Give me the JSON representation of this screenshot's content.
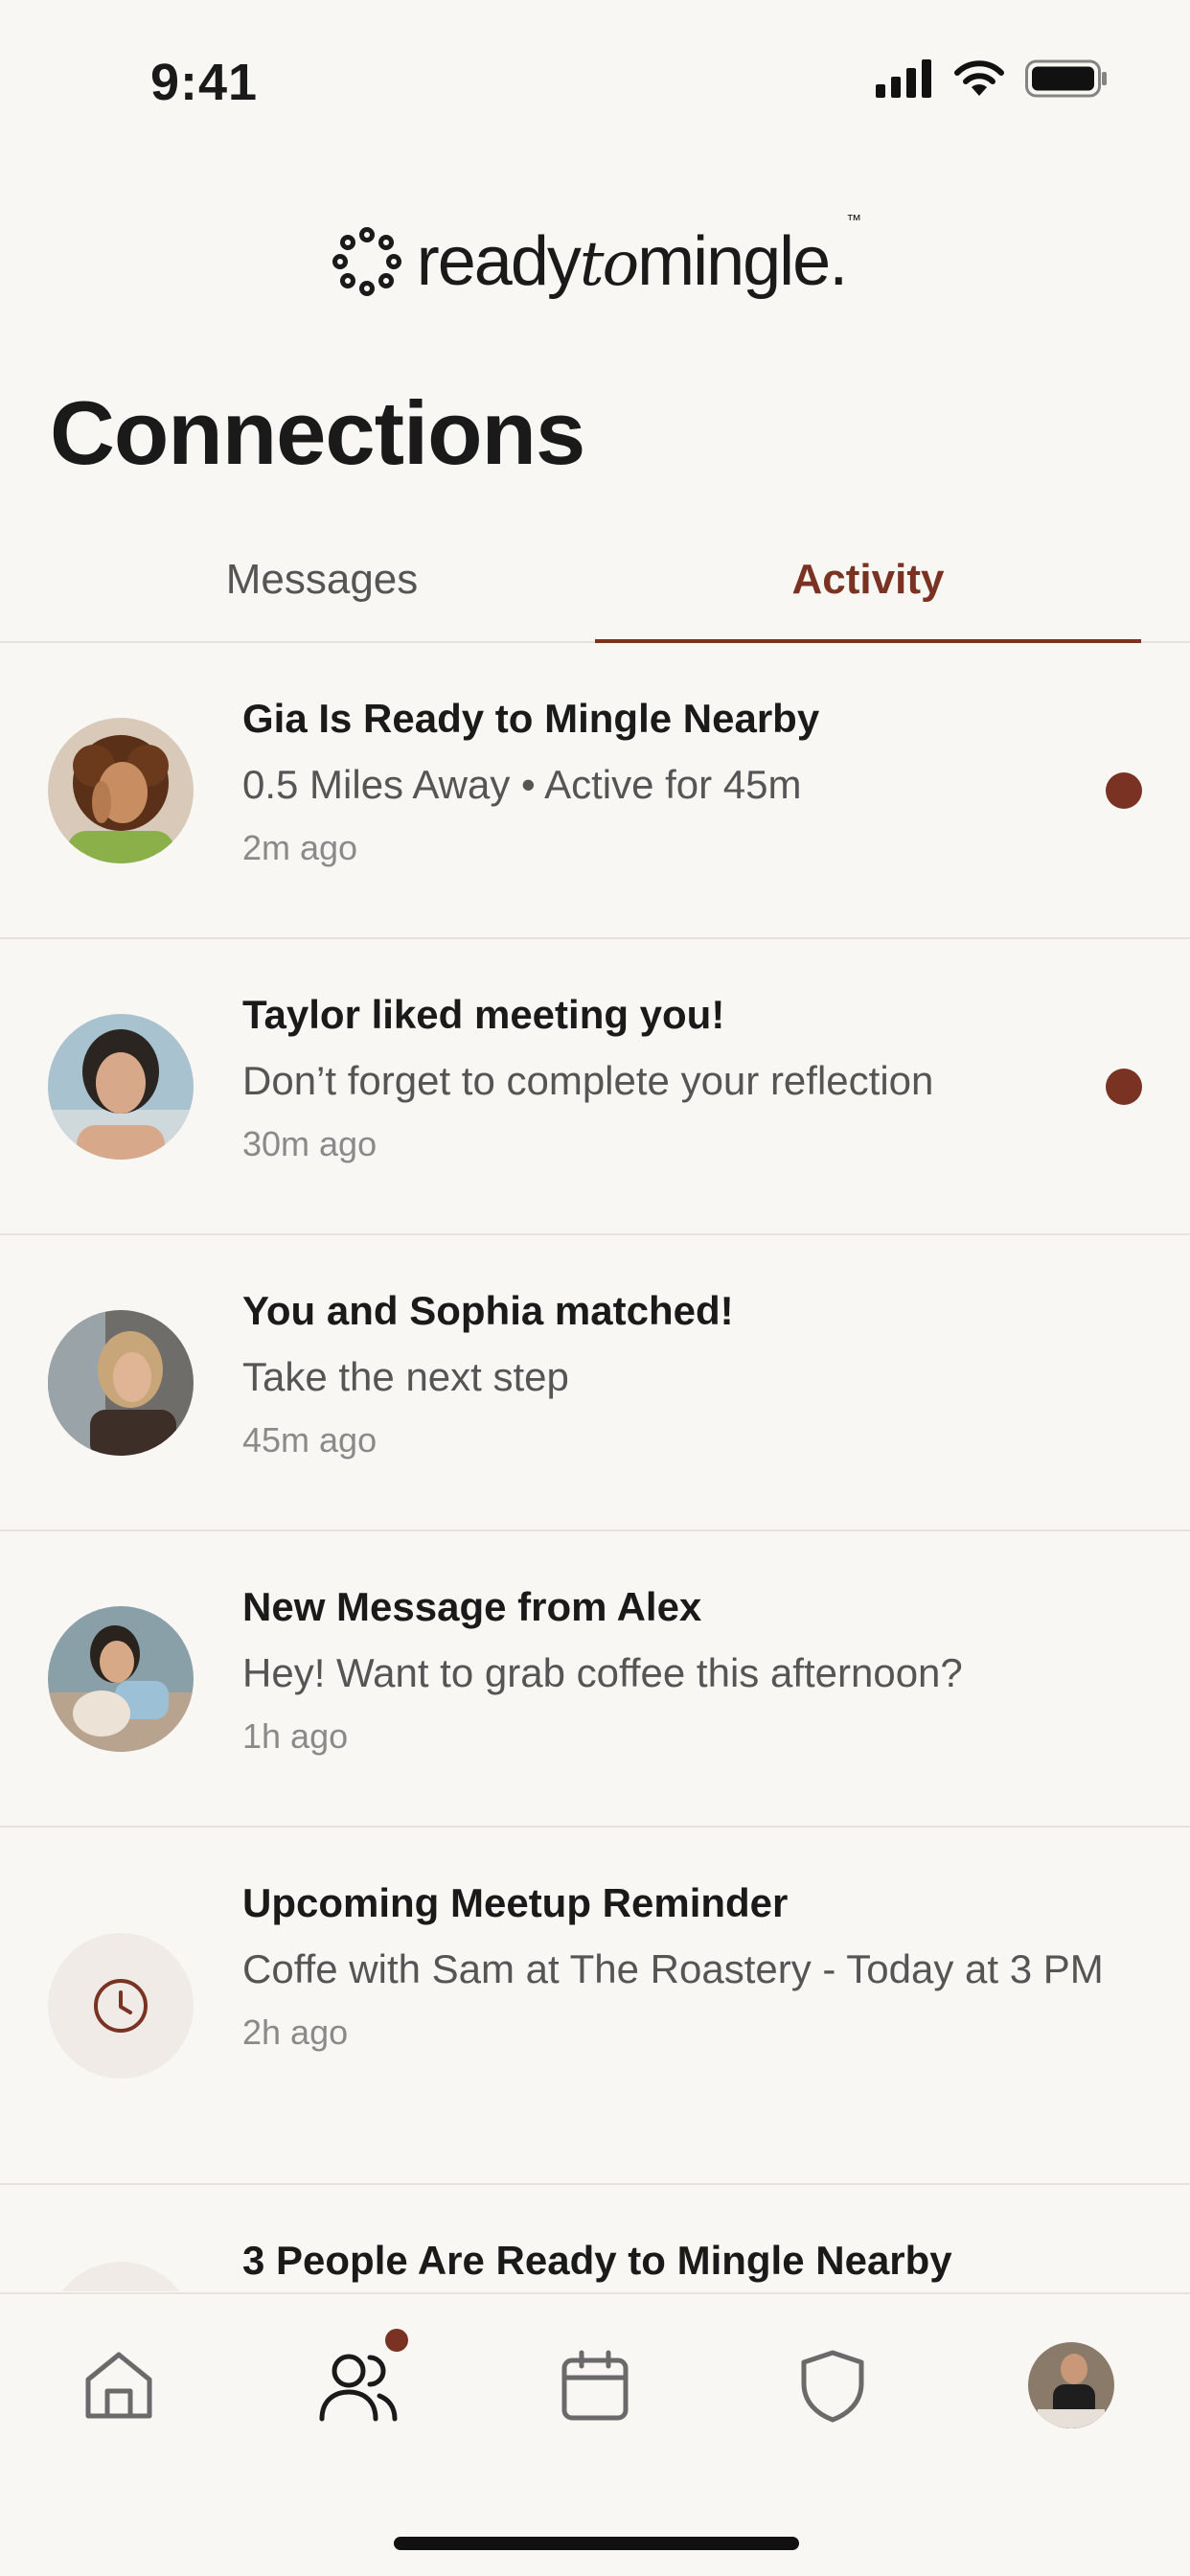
{
  "status_bar": {
    "time": "9:41"
  },
  "logo": {
    "part1": "ready",
    "part2": "to",
    "part3": "mingle.",
    "tm": "™"
  },
  "page_title": "Connections",
  "tabs": [
    {
      "label": "Messages",
      "active": false
    },
    {
      "label": "Activity",
      "active": true
    }
  ],
  "activity": [
    {
      "title": "Gia Is Ready to Mingle Nearby",
      "subtitle": "0.5 Miles Away • Active for 45m",
      "time": "2m ago",
      "unread": true
    },
    {
      "title": "Taylor liked meeting you!",
      "subtitle": "Don’t forget to complete your reflection",
      "time": "30m ago",
      "unread": true
    },
    {
      "title": "You and Sophia matched!",
      "subtitle": "Take the next step",
      "time": "45m ago",
      "unread": false
    },
    {
      "title": "New Message from Alex",
      "subtitle": "Hey! Want to grab coffee this afternoon?",
      "time": "1h ago",
      "unread": false
    },
    {
      "title": "Upcoming Meetup Reminder",
      "subtitle": "Coffe with Sam at The Roastery - Today at 3 PM",
      "time": "2h ago",
      "unread": false,
      "icon": "clock-icon"
    },
    {
      "title": "3 People Are Ready to Mingle Nearby"
    }
  ],
  "bottom_nav": [
    {
      "icon": "home-icon",
      "active": false
    },
    {
      "icon": "people-icon",
      "active": true,
      "badge": true
    },
    {
      "icon": "calendar-icon",
      "active": false
    },
    {
      "icon": "shield-icon",
      "active": false
    },
    {
      "icon": "profile-avatar",
      "active": false
    }
  ],
  "colors": {
    "accent": "#7a3222",
    "background": "#f9f7f4",
    "divider": "#e6e3df"
  }
}
